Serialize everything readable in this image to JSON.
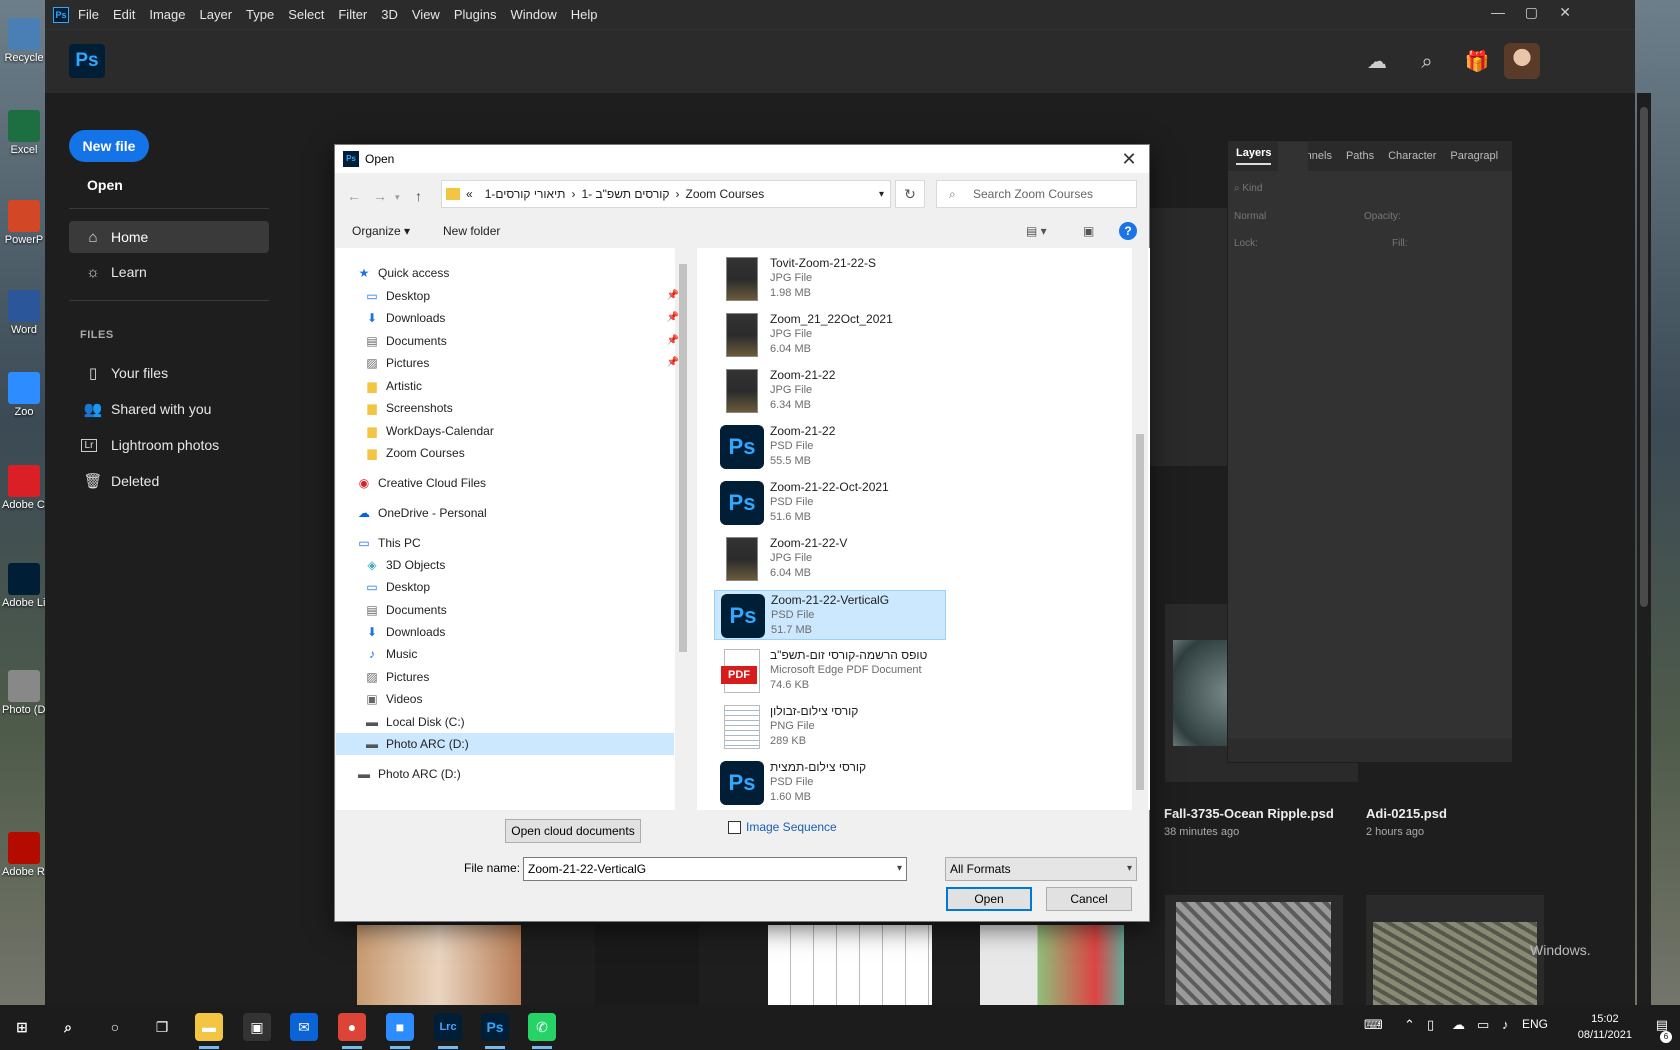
{
  "desktop": {
    "icons": [
      {
        "label": "Recycle",
        "icon": "recycle-bin-icon",
        "color": "#4a7fb5"
      },
      {
        "label": "Excel",
        "icon": "excel-icon",
        "color": "#1d6f42"
      },
      {
        "label": "PowerP",
        "icon": "powerpoint-icon",
        "color": "#d24726"
      },
      {
        "label": "Word",
        "icon": "word-icon",
        "color": "#2b579a"
      },
      {
        "label": "Zoo",
        "icon": "zoom-icon",
        "color": "#2d8cff"
      },
      {
        "label": "Adobe Creat",
        "icon": "creative-cloud-icon",
        "color": "#da1f26"
      },
      {
        "label": "Adobe Lightro",
        "icon": "lightroom-icon",
        "color": "#001e36"
      },
      {
        "label": "Photo (D) - Sh",
        "icon": "photo-shortcut-icon",
        "color": "#888888"
      },
      {
        "label": "Adobe Reade",
        "icon": "acrobat-reader-icon",
        "color": "#b30b00"
      }
    ]
  },
  "photoshop": {
    "menus": [
      "File",
      "Edit",
      "Image",
      "Layer",
      "Type",
      "Select",
      "Filter",
      "3D",
      "View",
      "Plugins",
      "Window",
      "Help"
    ],
    "app_icon": "Ps",
    "logo": "Ps",
    "accent": "#31a8ff"
  },
  "home": {
    "new_file": "New file",
    "open": "Open",
    "nav": [
      {
        "label": "Home",
        "icon": "home-icon"
      },
      {
        "label": "Learn",
        "icon": "lightbulb-icon"
      }
    ],
    "files_header": "FILES",
    "files": [
      {
        "label": "Your files",
        "icon": "file-icon"
      },
      {
        "label": "Shared with you",
        "icon": "people-icon"
      },
      {
        "label": "Lightroom photos",
        "icon": "lightroom-icon"
      },
      {
        "label": "Deleted",
        "icon": "trash-icon"
      }
    ]
  },
  "recent": [
    {
      "name": "Fall-3735-Ocean Ripple.psd",
      "time": "38 minutes ago"
    },
    {
      "name": "Adi-0215.psd",
      "time": "2 hours ago"
    }
  ],
  "watermark": "Windows.",
  "layers_panel": {
    "tabs": [
      "Layers",
      "Channels",
      "Paths",
      "Character",
      "Paragrapl"
    ],
    "kind": "Kind",
    "blend": "Normal",
    "opacity_label": "Opacity:",
    "lock_label": "Lock:",
    "fill_label": "Fill:"
  },
  "dialog": {
    "title": "Open",
    "title_icon": "Ps",
    "breadcrumb": [
      "«",
      "תיאורי קורסים-1",
      "קורסים תשפ\"ב -1",
      "Zoom Courses"
    ],
    "search_placeholder": "Search Zoom Courses",
    "organize": "Organize ▾",
    "new_folder": "New folder",
    "help": "?",
    "nav_items": [
      {
        "label": "Quick access",
        "icon": "star-icon",
        "level": 0,
        "pinned": false
      },
      {
        "label": "Desktop",
        "icon": "desktop-icon",
        "level": 1,
        "pinned": true
      },
      {
        "label": "Downloads",
        "icon": "download-icon",
        "level": 1,
        "pinned": true
      },
      {
        "label": "Documents",
        "icon": "documents-icon",
        "level": 1,
        "pinned": true
      },
      {
        "label": "Pictures",
        "icon": "pictures-icon",
        "level": 1,
        "pinned": true
      },
      {
        "label": "Artistic",
        "icon": "folder-icon",
        "level": 1,
        "pinned": false
      },
      {
        "label": "Screenshots",
        "icon": "folder-icon",
        "level": 1,
        "pinned": false
      },
      {
        "label": "WorkDays-Calendar",
        "icon": "folder-icon",
        "level": 1,
        "pinned": false
      },
      {
        "label": "Zoom Courses",
        "icon": "folder-icon",
        "level": 1,
        "pinned": false
      },
      {
        "label": "Creative Cloud Files",
        "icon": "creative-cloud-folder-icon",
        "level": 0,
        "pinned": false
      },
      {
        "label": "OneDrive - Personal",
        "icon": "onedrive-icon",
        "level": 0,
        "pinned": false
      },
      {
        "label": "This PC",
        "icon": "computer-icon",
        "level": 0,
        "pinned": false
      },
      {
        "label": "3D Objects",
        "icon": "3d-objects-icon",
        "level": 1,
        "pinned": false
      },
      {
        "label": "Desktop",
        "icon": "desktop-icon",
        "level": 1,
        "pinned": false
      },
      {
        "label": "Documents",
        "icon": "documents-icon",
        "level": 1,
        "pinned": false
      },
      {
        "label": "Downloads",
        "icon": "download-icon",
        "level": 1,
        "pinned": false
      },
      {
        "label": "Music",
        "icon": "music-icon",
        "level": 1,
        "pinned": false
      },
      {
        "label": "Pictures",
        "icon": "pictures-icon",
        "level": 1,
        "pinned": false
      },
      {
        "label": "Videos",
        "icon": "videos-icon",
        "level": 1,
        "pinned": false
      },
      {
        "label": "Local Disk (C:)",
        "icon": "drive-icon",
        "level": 1,
        "pinned": false
      },
      {
        "label": "Photo ARC (D:)",
        "icon": "drive-icon",
        "level": 1,
        "pinned": false,
        "selected": true
      },
      {
        "label": "Photo ARC (D:)",
        "icon": "drive-icon",
        "level": 0,
        "pinned": false
      }
    ],
    "files": [
      {
        "name": "Tovit-Zoom-21-22-S",
        "type": "JPG File",
        "size": "1.98 MB",
        "kind": "jpg"
      },
      {
        "name": "Zoom_21_22Oct_2021",
        "type": "JPG File",
        "size": "6.04 MB",
        "kind": "jpg"
      },
      {
        "name": "Zoom-21-22",
        "type": "JPG File",
        "size": "6.34 MB",
        "kind": "jpg"
      },
      {
        "name": "Zoom-21-22",
        "type": "PSD File",
        "size": "55.5 MB",
        "kind": "psd"
      },
      {
        "name": "Zoom-21-22-Oct-2021",
        "type": "PSD File",
        "size": "51.6 MB",
        "kind": "psd"
      },
      {
        "name": "Zoom-21-22-V",
        "type": "JPG File",
        "size": "6.04 MB",
        "kind": "jpg"
      },
      {
        "name": "Zoom-21-22-VerticalG",
        "type": "PSD File",
        "size": "51.7 MB",
        "kind": "psd",
        "selected": true
      },
      {
        "name": "טופס הרשמה-קורסי זום-תשפ\"ב",
        "type": "Microsoft Edge PDF Document",
        "size": "74.6 KB",
        "kind": "pdf"
      },
      {
        "name": "קורסי צילום-זבולון",
        "type": "PNG File",
        "size": "289 KB",
        "kind": "png"
      },
      {
        "name": "קורסי צילום-תמצית",
        "type": "PSD File",
        "size": "1.60 MB",
        "kind": "psd"
      }
    ],
    "open_cloud": "Open cloud documents",
    "image_sequence": "Image Sequence",
    "file_name_label": "File name:",
    "file_name_value": "Zoom-21-22-VerticalG",
    "format": "All Formats",
    "open_button": "Open",
    "cancel_button": "Cancel",
    "ps_badge": "Ps",
    "pdf_badge": "PDF"
  },
  "taskbar": {
    "apps": [
      {
        "name": "start",
        "icon": "windows-start-icon",
        "label": "⊞"
      },
      {
        "name": "search",
        "icon": "search-icon",
        "label": "⌕"
      },
      {
        "name": "cortana",
        "icon": "cortana-icon",
        "label": "○"
      },
      {
        "name": "task-view",
        "icon": "task-view-icon",
        "label": "❐"
      },
      {
        "name": "file-explorer",
        "icon": "folder-icon",
        "label": "▬"
      },
      {
        "name": "store",
        "icon": "store-icon",
        "label": "▣"
      },
      {
        "name": "mail",
        "icon": "mail-icon",
        "label": "✉"
      },
      {
        "name": "chrome",
        "icon": "chrome-icon",
        "label": "●"
      },
      {
        "name": "zoom",
        "icon": "zoom-icon",
        "label": "■"
      },
      {
        "name": "lightroom-classic",
        "icon": "lightroom-classic-icon",
        "label": "Lrc"
      },
      {
        "name": "photoshop",
        "icon": "photoshop-icon",
        "label": "Ps"
      },
      {
        "name": "whatsapp",
        "icon": "whatsapp-icon",
        "label": "✆"
      }
    ],
    "lang": "ENG",
    "time": "15:02",
    "date": "08/11/2021",
    "notifications": "6"
  }
}
